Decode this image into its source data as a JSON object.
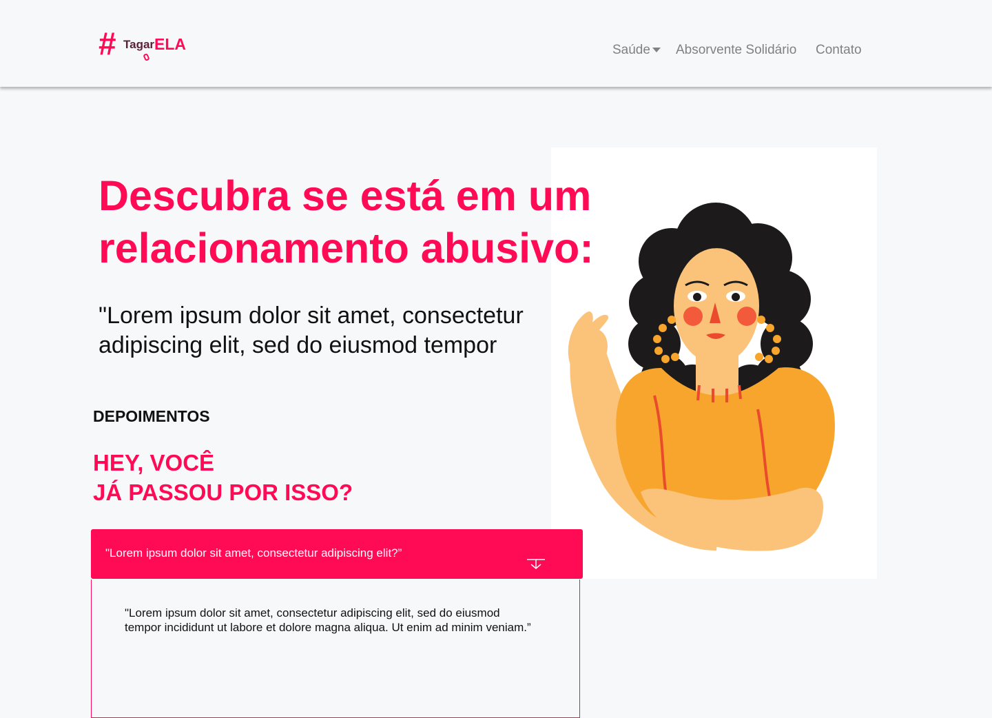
{
  "brand": {
    "hash": "#",
    "tagar": "Tagar",
    "ela": "ELA"
  },
  "nav": {
    "saude": "Saúde",
    "absorvente": "Absorvente Solidário",
    "contato": "Contato"
  },
  "hero": {
    "title": "Descubra se está em um relacionamento abusivo:",
    "quote": "\"Lorem ipsum dolor sit amet, consectetur adipiscing elit, sed do eiusmod tempor"
  },
  "depoimentos": {
    "label": "DEPOIMENTOS",
    "title_line1": "HEY, VOCÊ",
    "title_line2": "JÁ PASSOU POR ISSO?"
  },
  "accordion": {
    "question": "\"Lorem ipsum dolor sit amet, consectetur adipiscing elit?”",
    "answer": "\"Lorem ipsum dolor sit amet, consectetur adipiscing elit, sed do eiusmod tempor incididunt ut labore et dolore magna aliqua. Ut enim ad minim veniam.”"
  },
  "colors": {
    "accent": "#ff0a55",
    "navText": "#808085",
    "background": "#f7f8fa"
  },
  "icons": [
    "mic-icon",
    "caret-down-icon",
    "arrow-down-icon"
  ]
}
